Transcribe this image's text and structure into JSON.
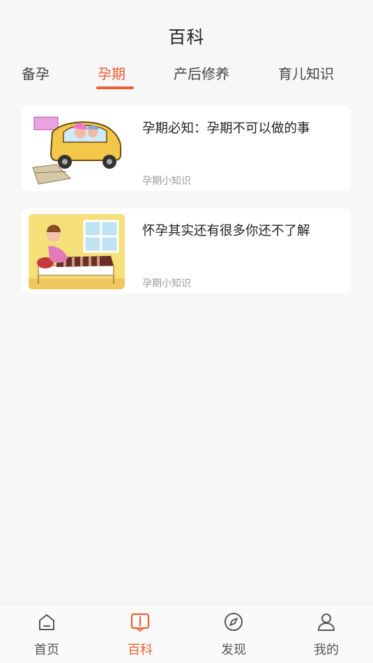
{
  "header": {
    "title": "百科"
  },
  "tabs": [
    {
      "label": "备孕",
      "active": false
    },
    {
      "label": "孕期",
      "active": true
    },
    {
      "label": "产后修养",
      "active": false
    },
    {
      "label": "育儿知识",
      "active": false
    }
  ],
  "articles": [
    {
      "title": "孕期必知：孕期不可以做的事",
      "category": "孕期小知识",
      "thumb_icon": "cartoon-car-image"
    },
    {
      "title": "怀孕其实还有很多你还不了解",
      "category": "孕期小知识",
      "thumb_icon": "cartoon-pregnant-woman-image"
    }
  ],
  "bottom_nav": [
    {
      "label": "首页",
      "icon": "home-icon",
      "active": false
    },
    {
      "label": "百科",
      "icon": "book-icon",
      "active": true
    },
    {
      "label": "发现",
      "icon": "compass-icon",
      "active": false
    },
    {
      "label": "我的",
      "icon": "user-icon",
      "active": false
    }
  ],
  "colors": {
    "accent": "#ef5d34",
    "background": "#f7f7f7"
  }
}
